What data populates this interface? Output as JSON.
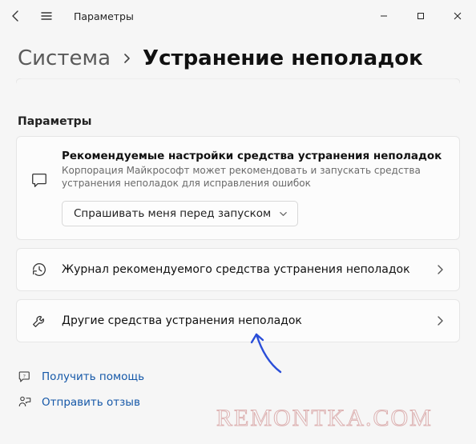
{
  "titlebar": {
    "app_title": "Параметры"
  },
  "breadcrumb": {
    "system": "Система",
    "current": "Устранение неполадок"
  },
  "section_label": "Параметры",
  "rec_card": {
    "title": "Рекомендуемые настройки средства устранения неполадок",
    "subtitle": "Корпорация Майкрософт может рекомендовать и запускать средства устранения неполадок для исправления ошибок",
    "dropdown_value": "Спрашивать меня перед запуском"
  },
  "history_card": {
    "title": "Журнал рекомендуемого средства устранения неполадок"
  },
  "other_card": {
    "title": "Другие средства устранения неполадок"
  },
  "links": {
    "help": "Получить помощь",
    "feedback": "Отправить отзыв"
  },
  "watermark": "REMONTKA.COM"
}
